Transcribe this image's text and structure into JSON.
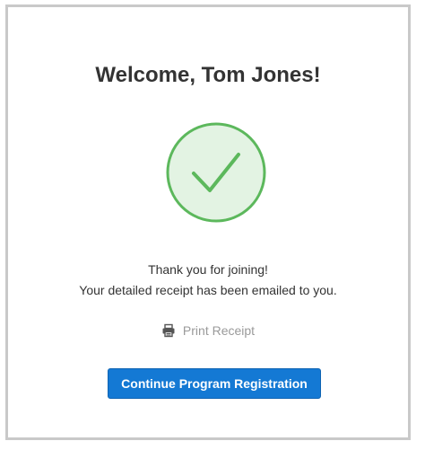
{
  "welcome": {
    "title": "Welcome, Tom Jones!"
  },
  "confirmation": {
    "icon": "checkmark-circle-icon",
    "line1": "Thank you for joining!",
    "line2": "Your detailed receipt has been emailed to you."
  },
  "actions": {
    "print_icon": "printer-icon",
    "print_label": "Print Receipt",
    "continue_label": "Continue Program Registration"
  },
  "colors": {
    "success_green": "#5cb85c",
    "success_fill": "#e3f3e3",
    "primary_button": "#1479d4",
    "muted_text": "#9a9a9a",
    "card_border": "#c9c9c9"
  }
}
